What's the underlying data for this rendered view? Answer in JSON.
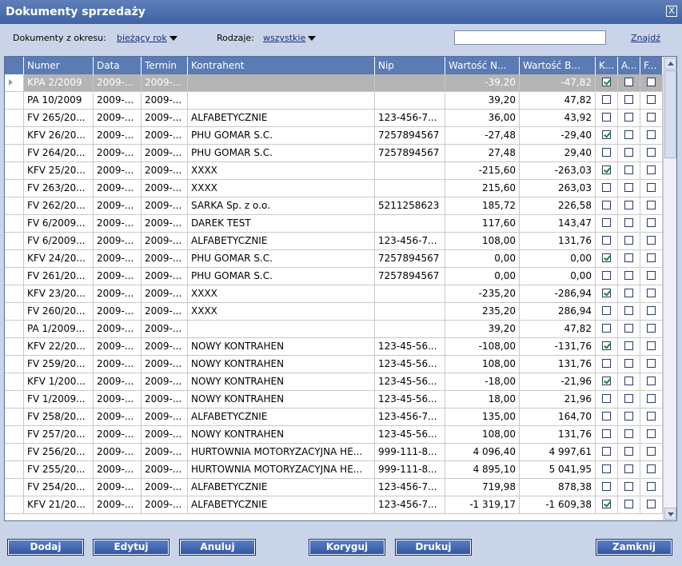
{
  "window": {
    "title": "Dokumenty sprzedaży",
    "close_glyph": "X"
  },
  "filters": {
    "period_label": "Dokumenty z okresu:",
    "period_value": "bieżący rok",
    "type_label": "Rodzaje:",
    "type_value": "wszystkie",
    "search_value": "",
    "find_label": "Znajdź"
  },
  "table": {
    "columns": [
      "Numer",
      "Data",
      "Termin",
      "Kontrahent",
      "Nip",
      "Wartość N...",
      "Wartość B...",
      "K...",
      "A...",
      "F..."
    ],
    "rows": [
      {
        "numer": "KPA 2/2009",
        "data": "2009-...",
        "termin": "2009-...",
        "kontrahent": "",
        "nip": "",
        "netto": "-39,20",
        "brutto": "-47,82",
        "k": true,
        "a": false,
        "f": false
      },
      {
        "numer": "PA 10/2009",
        "data": "2009-...",
        "termin": "2009-...",
        "kontrahent": "",
        "nip": "",
        "netto": "39,20",
        "brutto": "47,82",
        "k": false,
        "a": false,
        "f": false
      },
      {
        "numer": "FV 265/20...",
        "data": "2009-...",
        "termin": "2009-...",
        "kontrahent": "ALFABETYCZNIE",
        "nip": "123-456-7...",
        "netto": "36,00",
        "brutto": "43,92",
        "k": false,
        "a": false,
        "f": false
      },
      {
        "numer": "KFV 26/20...",
        "data": "2009-...",
        "termin": "2009-...",
        "kontrahent": "PHU GOMAR S.C.",
        "nip": "7257894567",
        "netto": "-27,48",
        "brutto": "-29,40",
        "k": true,
        "a": false,
        "f": false
      },
      {
        "numer": "FV 264/20...",
        "data": "2009-...",
        "termin": "2009-...",
        "kontrahent": "PHU GOMAR S.C.",
        "nip": "7257894567",
        "netto": "27,48",
        "brutto": "29,40",
        "k": false,
        "a": false,
        "f": false
      },
      {
        "numer": "KFV 25/20...",
        "data": "2009-...",
        "termin": "2009-...",
        "kontrahent": "XXXX",
        "nip": "",
        "netto": "-215,60",
        "brutto": "-263,03",
        "k": true,
        "a": false,
        "f": false
      },
      {
        "numer": "FV 263/20...",
        "data": "2009-...",
        "termin": "2009-...",
        "kontrahent": "XXXX",
        "nip": "",
        "netto": "215,60",
        "brutto": "263,03",
        "k": false,
        "a": false,
        "f": false
      },
      {
        "numer": "FV 262/20...",
        "data": "2009-...",
        "termin": "2009-...",
        "kontrahent": "SARKA Sp. z o.o.",
        "nip": "5211258623",
        "netto": "185,72",
        "brutto": "226,58",
        "k": false,
        "a": false,
        "f": false
      },
      {
        "numer": "FV 6/2009...",
        "data": "2009-...",
        "termin": "2009-...",
        "kontrahent": "DAREK TEST",
        "nip": "",
        "netto": "117,60",
        "brutto": "143,47",
        "k": false,
        "a": false,
        "f": false
      },
      {
        "numer": "FV 6/2009...",
        "data": "2009-...",
        "termin": "2009-...",
        "kontrahent": "ALFABETYCZNIE",
        "nip": "123-456-7...",
        "netto": "108,00",
        "brutto": "131,76",
        "k": false,
        "a": false,
        "f": false
      },
      {
        "numer": "KFV 24/20...",
        "data": "2009-...",
        "termin": "2009-...",
        "kontrahent": "PHU GOMAR S.C.",
        "nip": "7257894567",
        "netto": "0,00",
        "brutto": "0,00",
        "k": true,
        "a": false,
        "f": false
      },
      {
        "numer": "FV 261/20...",
        "data": "2009-...",
        "termin": "2009-...",
        "kontrahent": "PHU GOMAR S.C.",
        "nip": "7257894567",
        "netto": "0,00",
        "brutto": "0,00",
        "k": false,
        "a": false,
        "f": false
      },
      {
        "numer": "KFV 23/20...",
        "data": "2009-...",
        "termin": "2009-...",
        "kontrahent": "XXXX",
        "nip": "",
        "netto": "-235,20",
        "brutto": "-286,94",
        "k": true,
        "a": false,
        "f": false
      },
      {
        "numer": "FV 260/20...",
        "data": "2009-...",
        "termin": "2009-...",
        "kontrahent": "XXXX",
        "nip": "",
        "netto": "235,20",
        "brutto": "286,94",
        "k": false,
        "a": false,
        "f": false
      },
      {
        "numer": "PA 1/2009...",
        "data": "2009-...",
        "termin": "2009-...",
        "kontrahent": "",
        "nip": "",
        "netto": "39,20",
        "brutto": "47,82",
        "k": false,
        "a": false,
        "f": false
      },
      {
        "numer": "KFV 22/20...",
        "data": "2009-...",
        "termin": "2009-...",
        "kontrahent": "NOWY KONTRAHEN",
        "nip": "123-45-56...",
        "netto": "-108,00",
        "brutto": "-131,76",
        "k": true,
        "a": false,
        "f": false
      },
      {
        "numer": "FV 259/20...",
        "data": "2009-...",
        "termin": "2009-...",
        "kontrahent": "NOWY KONTRAHEN",
        "nip": "123-45-56...",
        "netto": "108,00",
        "brutto": "131,76",
        "k": false,
        "a": false,
        "f": false
      },
      {
        "numer": "KFV 1/200...",
        "data": "2009-...",
        "termin": "2009-...",
        "kontrahent": "NOWY KONTRAHEN",
        "nip": "123-45-56...",
        "netto": "-18,00",
        "brutto": "-21,96",
        "k": true,
        "a": false,
        "f": false
      },
      {
        "numer": "FV 1/2009...",
        "data": "2009-...",
        "termin": "2009-...",
        "kontrahent": "NOWY KONTRAHEN",
        "nip": "123-45-56...",
        "netto": "18,00",
        "brutto": "21,96",
        "k": false,
        "a": false,
        "f": false
      },
      {
        "numer": "FV 258/20...",
        "data": "2009-...",
        "termin": "2009-...",
        "kontrahent": "ALFABETYCZNIE",
        "nip": "123-456-7...",
        "netto": "135,00",
        "brutto": "164,70",
        "k": false,
        "a": false,
        "f": false
      },
      {
        "numer": "FV 257/20...",
        "data": "2009-...",
        "termin": "2009-...",
        "kontrahent": "NOWY KONTRAHEN",
        "nip": "123-45-56...",
        "netto": "108,00",
        "brutto": "131,76",
        "k": false,
        "a": false,
        "f": false
      },
      {
        "numer": "FV 256/20...",
        "data": "2009-...",
        "termin": "2009-...",
        "kontrahent": "HURTOWNIA MOTORYZACYJNA HE...",
        "nip": "999-111-8...",
        "netto": "4 096,40",
        "brutto": "4 997,61",
        "k": false,
        "a": false,
        "f": false
      },
      {
        "numer": "FV 255/20...",
        "data": "2009-...",
        "termin": "2009-...",
        "kontrahent": "HURTOWNIA MOTORYZACYJNA HE...",
        "nip": "999-111-8...",
        "netto": "4 895,10",
        "brutto": "5 041,95",
        "k": false,
        "a": false,
        "f": false
      },
      {
        "numer": "FV 254/20...",
        "data": "2009-...",
        "termin": "2009-...",
        "kontrahent": "ALFABETYCZNIE",
        "nip": "123-456-7...",
        "netto": "719,98",
        "brutto": "878,38",
        "k": false,
        "a": false,
        "f": false
      },
      {
        "numer": "KFV 21/20...",
        "data": "2009-...",
        "termin": "2009-...",
        "kontrahent": "ALFABETYCZNIE",
        "nip": "123-456-7...",
        "netto": "-1 319,17",
        "brutto": "-1 609,38",
        "k": true,
        "a": false,
        "f": false
      }
    ]
  },
  "buttons": {
    "add": "Dodaj",
    "edit": "Edytuj",
    "cancel": "Anuluj",
    "correct": "Koryguj",
    "print": "Drukuj",
    "close": "Zamknij"
  },
  "icons": {
    "row_pointer": "row-pointer-icon",
    "checkbox": "checkbox-icon"
  },
  "colors": {
    "titlebar": "#3e62a4",
    "header": "#5a7bb4",
    "selected_row": "#b4b4b4",
    "window_bg": "#c9d4e8",
    "check": "#1a8a2a"
  }
}
